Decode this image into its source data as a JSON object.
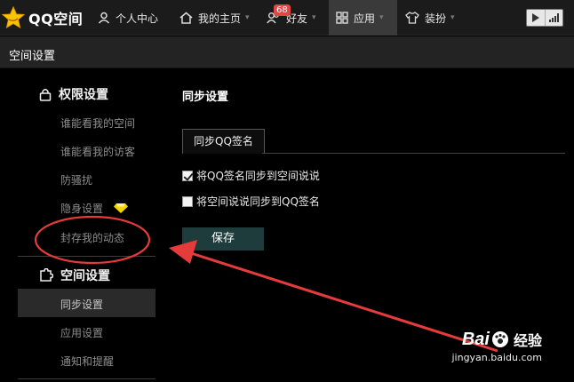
{
  "app": {
    "name": "QQ空间"
  },
  "nav": {
    "profile_center": "个人中心",
    "my_homepage": "我的主页",
    "friends": "好友",
    "friends_badge": "68",
    "apps": "应用",
    "dress_up": "装扮"
  },
  "section": {
    "title": "空间设置"
  },
  "sidebar": {
    "group1_title": "权限设置",
    "group1_items": [
      "谁能看我的空间",
      "谁能看我的访客",
      "防骚扰",
      "隐身设置",
      "封存我的动态"
    ],
    "group2_title": "空间设置",
    "group2_items": [
      "同步设置",
      "应用设置",
      "通知和提醒"
    ]
  },
  "main": {
    "title": "同步设置",
    "tab_label": "同步QQ签名",
    "option1": {
      "label": "将QQ签名同步到空间说说",
      "checked": true
    },
    "option2": {
      "label": "将空间说说同步到QQ签名",
      "checked": false
    },
    "save_label": "保存"
  },
  "watermark": {
    "brand": "Bai",
    "brand_suffix": "经验",
    "url": "jingyan.baidu.com"
  },
  "colors": {
    "accent_red": "#e53b3b",
    "diamond_yellow": "#f5d400",
    "save_bg": "#1e3c3c"
  }
}
